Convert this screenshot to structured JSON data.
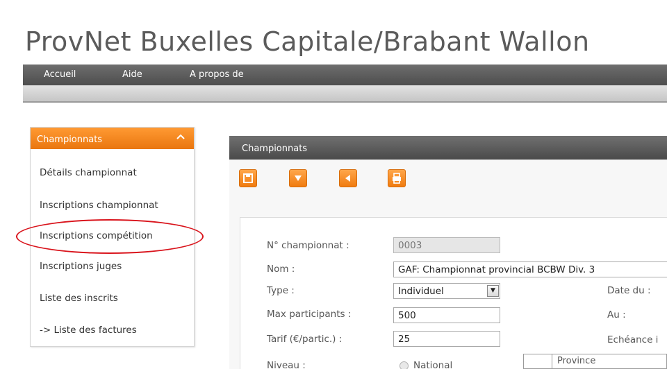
{
  "app": {
    "title": "ProvNet Buxelles Capitale/Brabant Wallon"
  },
  "menu": {
    "items": [
      "Accueil",
      "Aide",
      "A propos de"
    ]
  },
  "sidebar": {
    "header": "Championnats",
    "items": [
      "Détails championnat",
      "Inscriptions championnat",
      "Inscriptions compétition",
      "Inscriptions juges",
      "Liste des inscrits",
      "-> Liste des factures"
    ]
  },
  "panel": {
    "title": "Championnats",
    "toolbar": {
      "icons": [
        "save-icon",
        "dropdown-icon",
        "back-icon",
        "print-icon"
      ]
    }
  },
  "form": {
    "numero_label": "N° championnat :",
    "numero_value": "0003",
    "nom_label": "Nom :",
    "nom_value": "GAF: Championnat provincial BCBW Div. 3",
    "type_label": "Type :",
    "type_value": "Individuel",
    "max_label": "Max participants :",
    "max_value": "500",
    "tarif_label": "Tarif (€/partic.) :",
    "tarif_value": "25",
    "niveau_label": "Niveau :",
    "niveau_option": "National",
    "date_du_label": "Date du :",
    "au_label": "Au :",
    "echeance_label": "Echéance i",
    "province_label": "Province"
  },
  "colors": {
    "accent": "#f07c10",
    "highlight": "#d9141c",
    "bar": "#5a5a5a"
  }
}
